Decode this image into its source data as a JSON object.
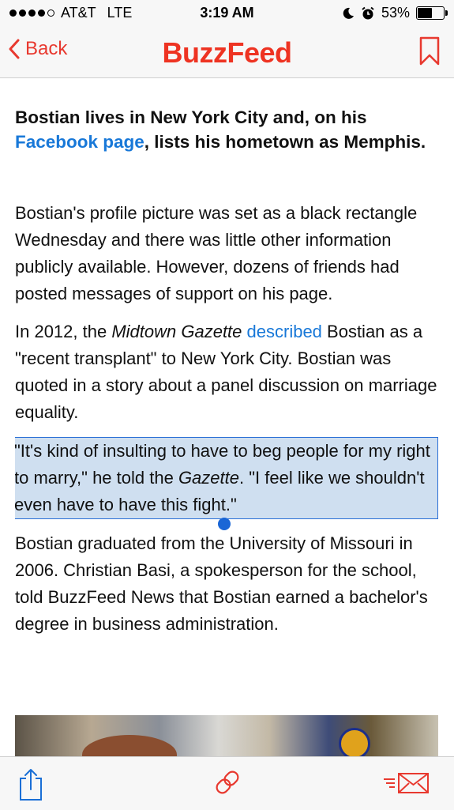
{
  "status_bar": {
    "carrier": "AT&T",
    "network": "LTE",
    "time": "3:19 AM",
    "battery": "53%",
    "battery_level": 0.53,
    "icons": [
      "signal-dots-icon",
      "moon-icon",
      "alarm-icon",
      "battery-icon"
    ]
  },
  "nav": {
    "back_label": "Back",
    "logo": "BuzzFeed",
    "accent_color": "#ee3322"
  },
  "article": {
    "lead_before": "Bostian lives in New York City and, on his ",
    "lead_link": "Facebook page",
    "lead_after": ", lists his hometown as Memphis.",
    "p1": "Bostian's profile picture was set as a black rectangle Wednesday and there was little other information publicly available. However, dozens of friends had posted messages of support on his page.",
    "p2_a": "In 2012, the ",
    "p2_italic": "Midtown Gazette",
    "p2_link": "described",
    "p2_b": " Bostian as a \"recent transplant\" to New York City. Bostian was quoted in a story about a panel discussion on marriage equality.",
    "p3_a": "\"It's kind of insulting to have to beg people for my right to marry,\" he told the ",
    "p3_italic": "Gazette",
    "p3_b": ". \"I feel like we shouldn't even have to have this fight.\"",
    "p4": "Bostian graduated from the University of Missouri in 2006. Christian Basi, a spokesperson for the school, told BuzzFeed News that Bostian earned a bachelor's degree in business administration.",
    "link_color": "#1878d8",
    "selection_color": "#cfdff0"
  },
  "toolbar": {
    "icons": [
      "share-icon",
      "link-icon",
      "email-icon"
    ]
  }
}
